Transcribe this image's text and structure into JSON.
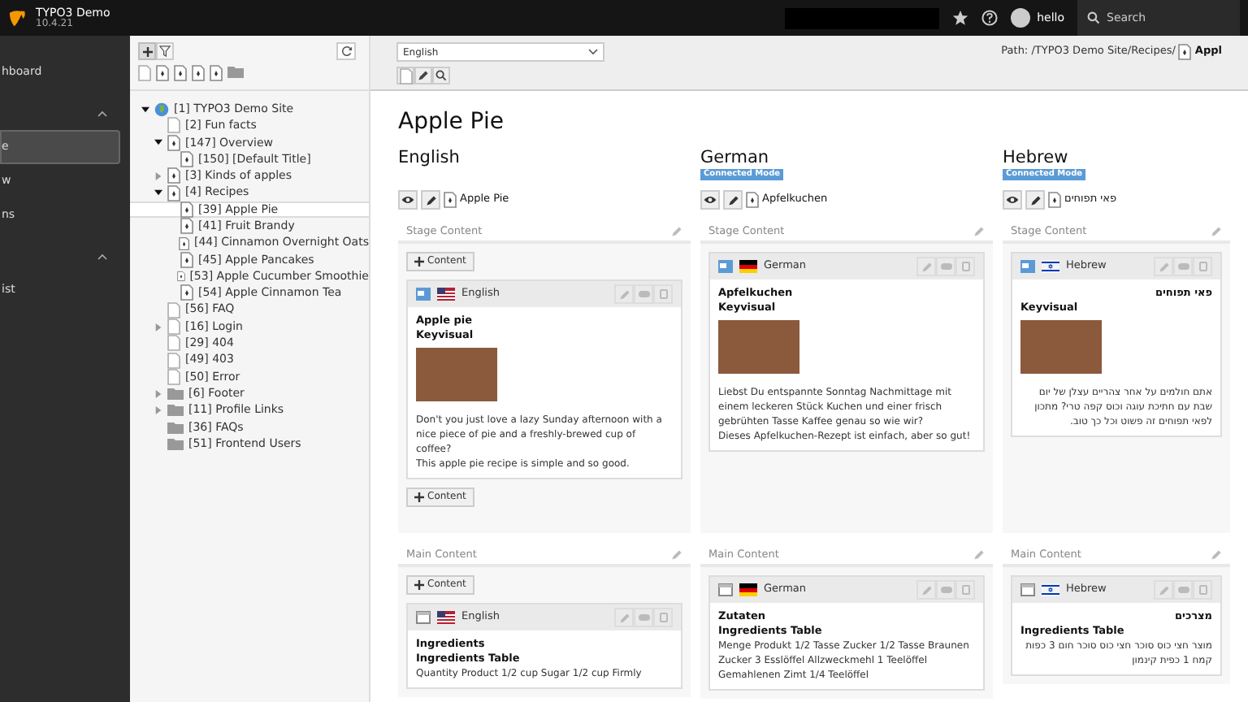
{
  "topbar": {
    "title": "TYPO3 Demo",
    "version": "10.4.21",
    "user": "hello",
    "search_placeholder": "Search"
  },
  "modules": [
    {
      "kind": "item",
      "label": "hboard",
      "selected": false
    },
    {
      "kind": "group",
      "expanded": true
    },
    {
      "kind": "item",
      "label": "e",
      "selected": true
    },
    {
      "kind": "item",
      "label": "w",
      "selected": false
    },
    {
      "kind": "item",
      "label": "ns",
      "selected": false
    },
    {
      "kind": "group",
      "expanded": true
    },
    {
      "kind": "item",
      "label": "ist",
      "selected": false
    }
  ],
  "tree": [
    {
      "label": "[1] TYPO3 Demo Site",
      "kind": "site",
      "selected": false,
      "expanded": true,
      "children": [
        {
          "label": "[2] Fun facts",
          "kind": "page",
          "selected": false
        },
        {
          "label": "[147] Overview",
          "kind": "special",
          "selected": false,
          "expanded": true,
          "children": [
            {
              "label": "[150] [Default Title]",
              "kind": "special",
              "selected": false
            }
          ]
        },
        {
          "label": "[3] Kinds of apples",
          "kind": "special",
          "selected": false,
          "expanded": false
        },
        {
          "label": "[4] Recipes",
          "kind": "special",
          "selected": false,
          "expanded": true,
          "children": [
            {
              "label": "[39] Apple Pie",
              "kind": "special",
              "selected": true
            },
            {
              "label": "[41] Fruit Brandy",
              "kind": "special",
              "selected": false
            },
            {
              "label": "[44] Cinnamon Overnight Oats",
              "kind": "special",
              "selected": false
            },
            {
              "label": "[45] Apple Pancakes",
              "kind": "special",
              "selected": false
            },
            {
              "label": "[53] Apple Cucumber Smoothie",
              "kind": "special",
              "selected": false
            },
            {
              "label": "[54] Apple Cinnamon Tea",
              "kind": "special",
              "selected": false
            }
          ]
        },
        {
          "label": "[56] FAQ",
          "kind": "page",
          "selected": false
        },
        {
          "label": "[16] Login",
          "kind": "page",
          "selected": false,
          "expanded": false
        },
        {
          "label": "[29] 404",
          "kind": "page",
          "selected": false
        },
        {
          "label": "[49] 403",
          "kind": "page",
          "selected": false
        },
        {
          "label": "[50] Error",
          "kind": "page",
          "selected": false
        },
        {
          "label": "[6] Footer",
          "kind": "folder",
          "selected": false,
          "expanded": false
        },
        {
          "label": "[11] Profile Links",
          "kind": "folder",
          "selected": false,
          "expanded": false
        },
        {
          "label": "[36] FAQs",
          "kind": "folder",
          "selected": false
        },
        {
          "label": "[51] Frontend Users",
          "kind": "folder",
          "selected": false
        }
      ]
    }
  ],
  "docheader": {
    "language": "English",
    "path_label": "Path: /TYPO3 Demo Site/Recipes/",
    "path_page": "Appl"
  },
  "page_title": "Apple Pie",
  "columns": [
    {
      "language": "English",
      "page_name": "Apple Pie",
      "sections": [
        {
          "name": "Stage Content",
          "add_before": "Content",
          "add_after": "Content",
          "elements": [
            {
              "kind": "image",
              "language": "English",
              "header": "Apple pie",
              "subheader": "Keyvisual",
              "image": true,
              "body": "Don't you just love a lazy Sunday afternoon with a nice piece of pie and a freshly-brewed cup of coffee?\nThis apple pie recipe is simple and so good.",
              "rtl": false
            }
          ]
        },
        {
          "name": "Main Content",
          "add_before": "Content",
          "elements": [
            {
              "kind": "table",
              "language": "English",
              "header": "Ingredients",
              "subheader": "Ingredients Table",
              "image": false,
              "body": "Quantity Product 1/2 cup Sugar 1/2 cup Firmly",
              "rtl": false
            }
          ]
        }
      ]
    },
    {
      "language": "German",
      "badge": "Connected Mode",
      "page_name": "Apfelkuchen",
      "sections": [
        {
          "name": "Stage Content",
          "elements": [
            {
              "kind": "image",
              "language": "German",
              "header": "Apfelkuchen",
              "subheader": "Keyvisual",
              "image": true,
              "body": "Liebst Du entspannte Sonntag Nachmittage mit einem leckeren Stück Kuchen und einer frisch gebrühten Tasse Kaffee genau so wie wir?\nDieses Apfelkuchen-Rezept ist einfach, aber so gut!",
              "rtl": false
            }
          ]
        },
        {
          "name": "Main Content",
          "elements": [
            {
              "kind": "table",
              "language": "German",
              "header": "Zutaten",
              "subheader": "Ingredients Table",
              "image": false,
              "body": "Menge Produkt 1/2 Tasse Zucker 1/2 Tasse Braunen Zucker 3 Esslöffel Allzweckmehl 1 Teelöffel Gemahlenen Zimt 1/4 Teelöffel",
              "rtl": false
            }
          ]
        }
      ]
    },
    {
      "language": "Hebrew",
      "badge": "Connected Mode",
      "page_name": "פאי תפוחים",
      "sections": [
        {
          "name": "Stage Content",
          "elements": [
            {
              "kind": "image",
              "language": "Hebrew",
              "header": "פאי תפוחים",
              "subheader": "Keyvisual",
              "image": true,
              "body": "אתם חולמים על אחר צהריים עצלן של יום שבת עם חתיכת עוגה וכוס קפה טרי? מתכון לפאי תפוחים זה פשוט וכל כך טוב.",
              "rtl": true
            }
          ]
        },
        {
          "name": "Main Content",
          "elements": [
            {
              "kind": "table",
              "language": "Hebrew",
              "header": "מצרכים",
              "subheader": "Ingredients Table",
              "image": false,
              "body": "מוצר חצי כוס סוכר חצי כוס סוכר חום 3 כפות קמח 1 כפית קינמון",
              "rtl": true
            }
          ]
        }
      ]
    }
  ]
}
